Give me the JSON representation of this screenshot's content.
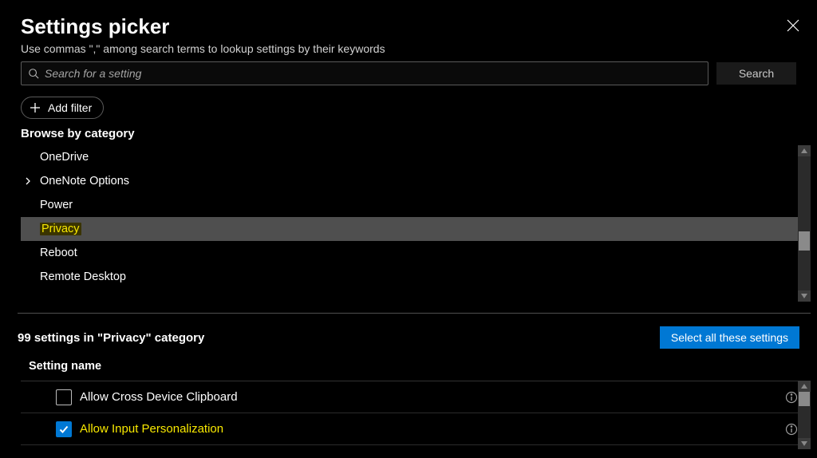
{
  "header": {
    "title": "Settings picker",
    "subtitle": "Use commas \",\" among search terms to lookup settings by their keywords"
  },
  "search": {
    "placeholder": "Search for a setting",
    "button": "Search"
  },
  "add_filter_label": "Add filter",
  "browse_label": "Browse by category",
  "categories": [
    {
      "label": "OneDrive",
      "expandable": false,
      "selected": false
    },
    {
      "label": "OneNote Options",
      "expandable": true,
      "selected": false
    },
    {
      "label": "Power",
      "expandable": false,
      "selected": false
    },
    {
      "label": "Privacy",
      "expandable": false,
      "selected": true
    },
    {
      "label": "Reboot",
      "expandable": false,
      "selected": false
    },
    {
      "label": "Remote Desktop",
      "expandable": false,
      "selected": false
    }
  ],
  "results": {
    "count_text": "99 settings in \"Privacy\" category",
    "select_all": "Select all these settings",
    "column_header": "Setting name"
  },
  "settings": [
    {
      "label": "Allow Cross Device Clipboard",
      "checked": false,
      "highlighted": false
    },
    {
      "label": "Allow Input Personalization",
      "checked": true,
      "highlighted": true
    }
  ]
}
